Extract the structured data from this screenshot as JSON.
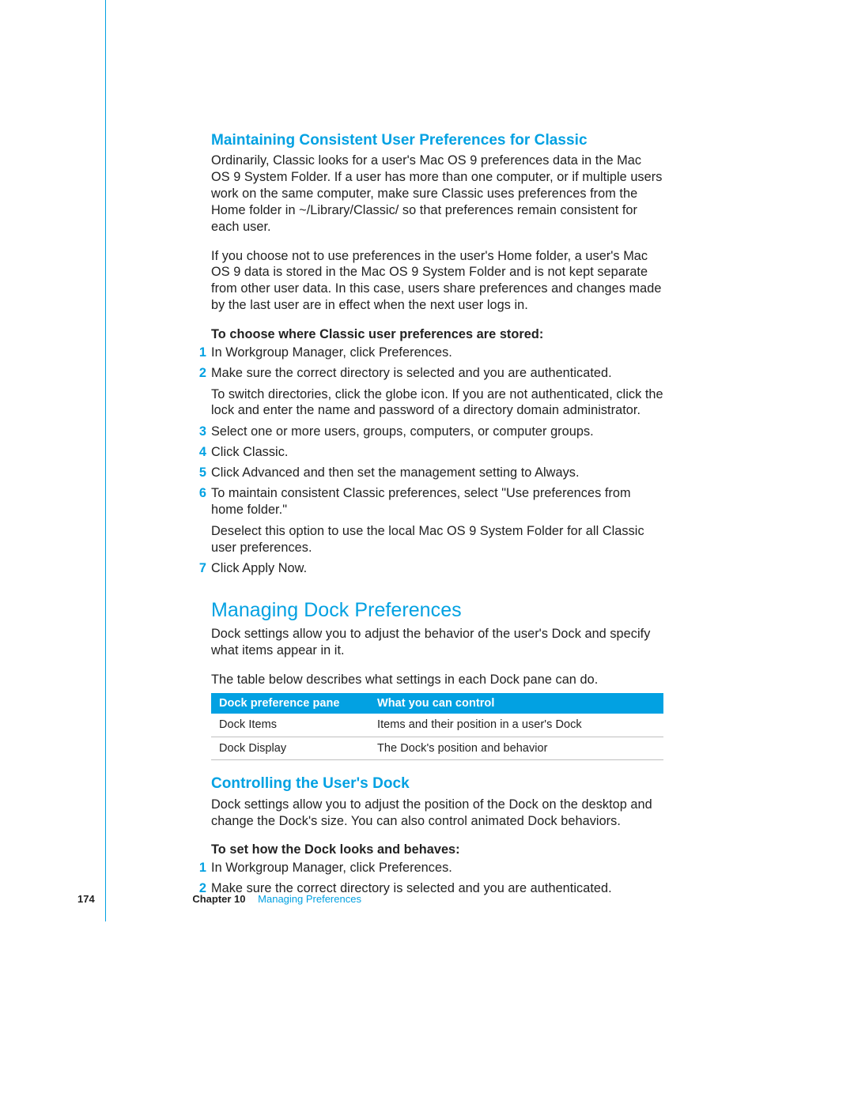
{
  "section1": {
    "heading": "Maintaining Consistent User Preferences for Classic",
    "p1": "Ordinarily, Classic looks for a user's Mac OS 9 preferences data in the Mac OS 9 System Folder. If a user has more than one computer, or if multiple users work on the same computer, make sure Classic uses preferences from the Home folder in ~/Library/Classic/ so that preferences remain consistent for each user.",
    "p2": "If you choose not to use preferences in the user's Home folder, a user's Mac OS 9 data is stored in the Mac OS 9 System Folder and is not kept separate from other user data. In this case, users share preferences and changes made by the last user are in effect when the next user logs in.",
    "instr_title": "To choose where Classic user preferences are stored:",
    "steps": [
      {
        "n": "1",
        "t": "In Workgroup Manager, click Preferences."
      },
      {
        "n": "2",
        "t": "Make sure the correct directory is selected and you are authenticated.",
        "t2": "To switch directories, click the globe icon. If you are not authenticated, click the lock and enter the name and password of a directory domain administrator."
      },
      {
        "n": "3",
        "t": "Select one or more users, groups, computers, or computer groups."
      },
      {
        "n": "4",
        "t": "Click Classic."
      },
      {
        "n": "5",
        "t": "Click Advanced and then set the management setting to Always."
      },
      {
        "n": "6",
        "t": "To maintain consistent Classic preferences, select \"Use preferences from home folder.\"",
        "t2": "Deselect this option to use the local Mac OS 9 System Folder for all Classic user preferences."
      },
      {
        "n": "7",
        "t": "Click Apply Now."
      }
    ]
  },
  "section2": {
    "heading": "Managing Dock Preferences",
    "p1": "Dock settings allow you to adjust the behavior of the user's Dock and specify what items appear in it.",
    "p2": "The table below describes what settings in each Dock pane can do.",
    "table": {
      "h1": "Dock preference pane",
      "h2": "What you can control",
      "rows": [
        {
          "c1": "Dock Items",
          "c2": "Items and their position in a user's Dock"
        },
        {
          "c1": "Dock Display",
          "c2": "The Dock's position and behavior"
        }
      ]
    }
  },
  "section3": {
    "heading": "Controlling the User's Dock",
    "p1": "Dock settings allow you to adjust the position of the Dock on the desktop and change the Dock's size. You can also control animated Dock behaviors.",
    "instr_title": "To set how the Dock looks and behaves:",
    "steps": [
      {
        "n": "1",
        "t": "In Workgroup Manager, click Preferences."
      },
      {
        "n": "2",
        "t": "Make sure the correct directory is selected and you are authenticated."
      }
    ]
  },
  "footer": {
    "page": "174",
    "chapter_label": "Chapter 10",
    "chapter_title": "Managing Preferences"
  }
}
